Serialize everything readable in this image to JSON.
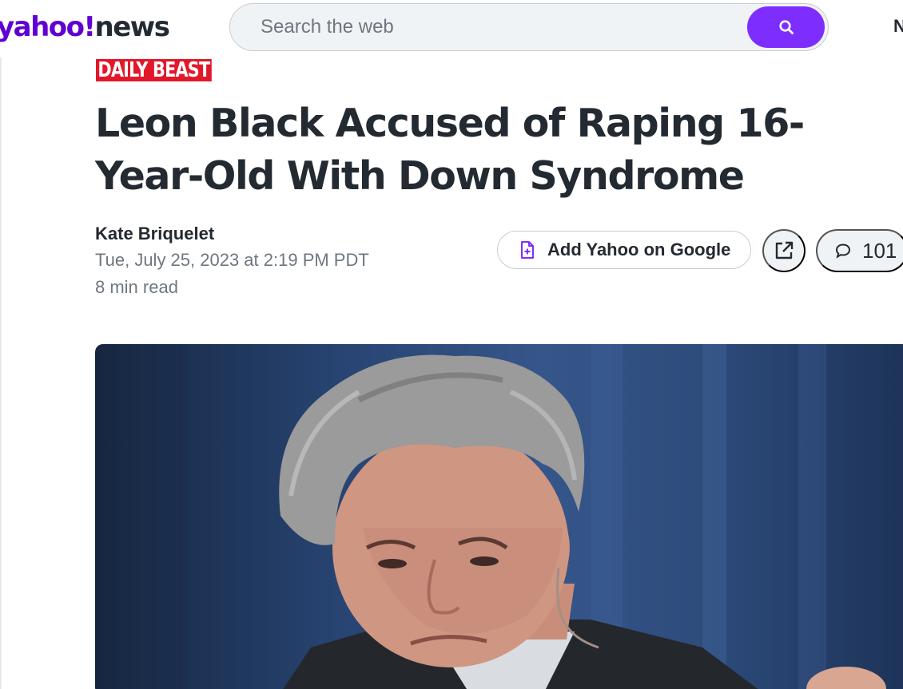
{
  "header": {
    "logo_yahoo": "yahoo",
    "logo_bang": "!",
    "logo_news": "news",
    "search_placeholder": "Search the web",
    "nav_partial": "N"
  },
  "article": {
    "provider": "DAILY BEAST",
    "title": "Leon Black Accused of Raping 16-Year-Old With Down Syndrome",
    "author": "Kate Briquelet",
    "date": "Tue, July 25, 2023 at 2:19 PM PDT",
    "read_time": "8 min read"
  },
  "actions": {
    "add_google_label": "Add Yahoo on Google",
    "comment_count": "101"
  },
  "colors": {
    "brand_purple": "#6001d2",
    "search_button": "#7d2eff",
    "provider_red": "#e2182a"
  },
  "icons": [
    "search-icon",
    "add-source-icon",
    "share-icon",
    "comment-icon"
  ]
}
